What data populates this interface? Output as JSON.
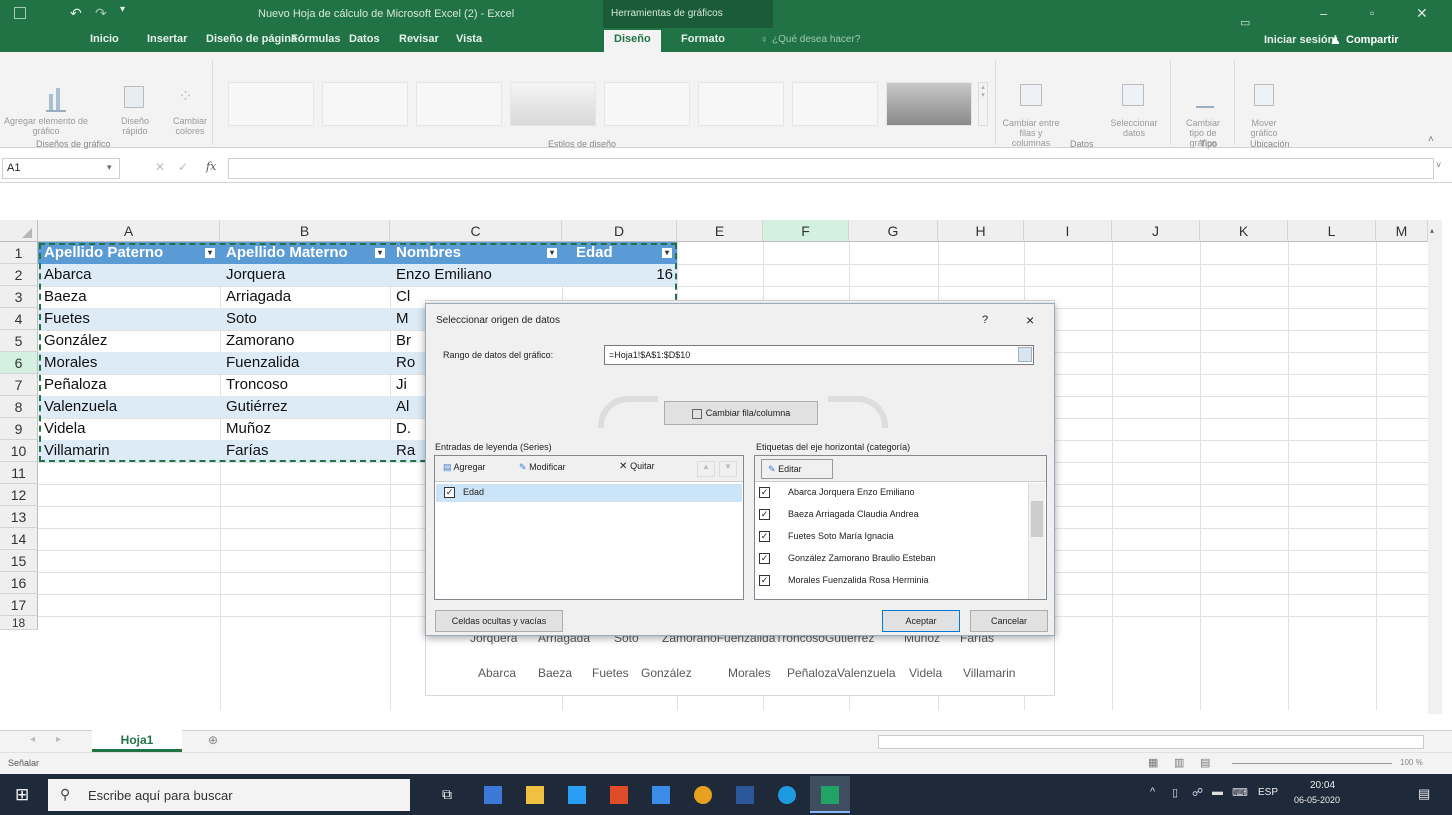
{
  "titlebar": {
    "doc_title": "Nuevo Hoja de cálculo de Microsoft Excel (2) - Excel",
    "context_title": "Herramientas de gráficos",
    "signin": "Iniciar sesión",
    "share": "Compartir"
  },
  "tabs": [
    "Inicio",
    "Insertar",
    "Diseño de página",
    "Fórmulas",
    "Datos",
    "Revisar",
    "Vista",
    "Diseño",
    "Formato"
  ],
  "tellme": "¿Qué desea hacer?",
  "ribbon": {
    "add_element": "Agregar elemento de gráfico",
    "quick_layout": "Diseño rápido",
    "change_colors": "Cambiar colores",
    "group_layouts": "Diseños de gráfico",
    "group_styles": "Estilos de diseño",
    "switch_rowcol": "Cambiar entre filas y columnas",
    "select_data": "Seleccionar datos",
    "group_data": "Datos",
    "change_type": "Cambiar tipo de gráfico",
    "group_type": "Tipo",
    "move_chart": "Mover gráfico",
    "group_location": "Ubicación"
  },
  "formula_bar": {
    "name_box": "A1",
    "fx": "fx",
    "value": ""
  },
  "columns": [
    "A",
    "B",
    "C",
    "D",
    "E",
    "F",
    "G",
    "H",
    "I",
    "J",
    "K",
    "L",
    "M"
  ],
  "rows": [
    "1",
    "2",
    "3",
    "4",
    "5",
    "6",
    "7",
    "8",
    "9",
    "10",
    "11",
    "12",
    "13",
    "14",
    "15",
    "16",
    "17",
    "18"
  ],
  "table": {
    "headers": [
      "Apellido Paterno",
      "Apellido Materno",
      "Nombres",
      "Edad"
    ],
    "data": [
      [
        "Abarca",
        "Jorquera",
        "Enzo Emiliano",
        "16"
      ],
      [
        "Baeza",
        "Arriagada",
        "Cl",
        ""
      ],
      [
        "Fuetes",
        "Soto",
        "M",
        ""
      ],
      [
        "González",
        "Zamorano",
        "Br",
        ""
      ],
      [
        "Morales",
        "Fuenzalida",
        "Ro",
        ""
      ],
      [
        "Peñaloza",
        "Troncoso",
        "Ji",
        ""
      ],
      [
        "Valenzuela",
        "Gutiérrez",
        "Al",
        ""
      ],
      [
        "Videla",
        "Muñoz",
        "D.",
        ""
      ],
      [
        "Villamarin",
        "Farías",
        "Ra",
        ""
      ]
    ]
  },
  "chart_axis": {
    "row1": [
      "Jorquera",
      "Arriagada",
      "Soto",
      "ZamoranoFuenzalidaTroncosoGutiérrez",
      "Muñoz",
      "Farías"
    ],
    "row2": [
      "Abarca",
      "Baeza",
      "Fuetes",
      "González",
      "Morales",
      "PeñalozaValenzuela",
      "Videla",
      "Villamarin"
    ]
  },
  "dialog": {
    "title": "Seleccionar origen de datos",
    "help": "?",
    "close": "×",
    "range_label": "Rango de datos del gráfico:",
    "range_value": "=Hoja1!$A$1:$D$10",
    "switch_button": "Cambiar fila/columna",
    "legend_label": "Entradas de leyenda (Series)",
    "add": "Agregar",
    "modify": "Modificar",
    "remove": "Quitar",
    "series": [
      "Edad"
    ],
    "axis_label": "Etiquetas del eje horizontal (categoría)",
    "edit": "Editar",
    "categories": [
      "Abarca Jorquera Enzo Emiliano",
      "Baeza Arriagada Claudia Andrea",
      "Fuetes Soto María Ignacia",
      "González Zamorano Braulio Esteban",
      "Morales Fuenzalida Rosa Herminia"
    ],
    "hidden_cells": "Celdas ocultas y vacías",
    "ok": "Aceptar",
    "cancel": "Cancelar"
  },
  "sheet_tab": "Hoja1",
  "status": {
    "mode": "Señalar",
    "zoom": "100 %"
  },
  "taskbar": {
    "search": "Escribe aquí para buscar",
    "lang": "ESP",
    "time": "20:04",
    "date": "06-05-2020"
  }
}
